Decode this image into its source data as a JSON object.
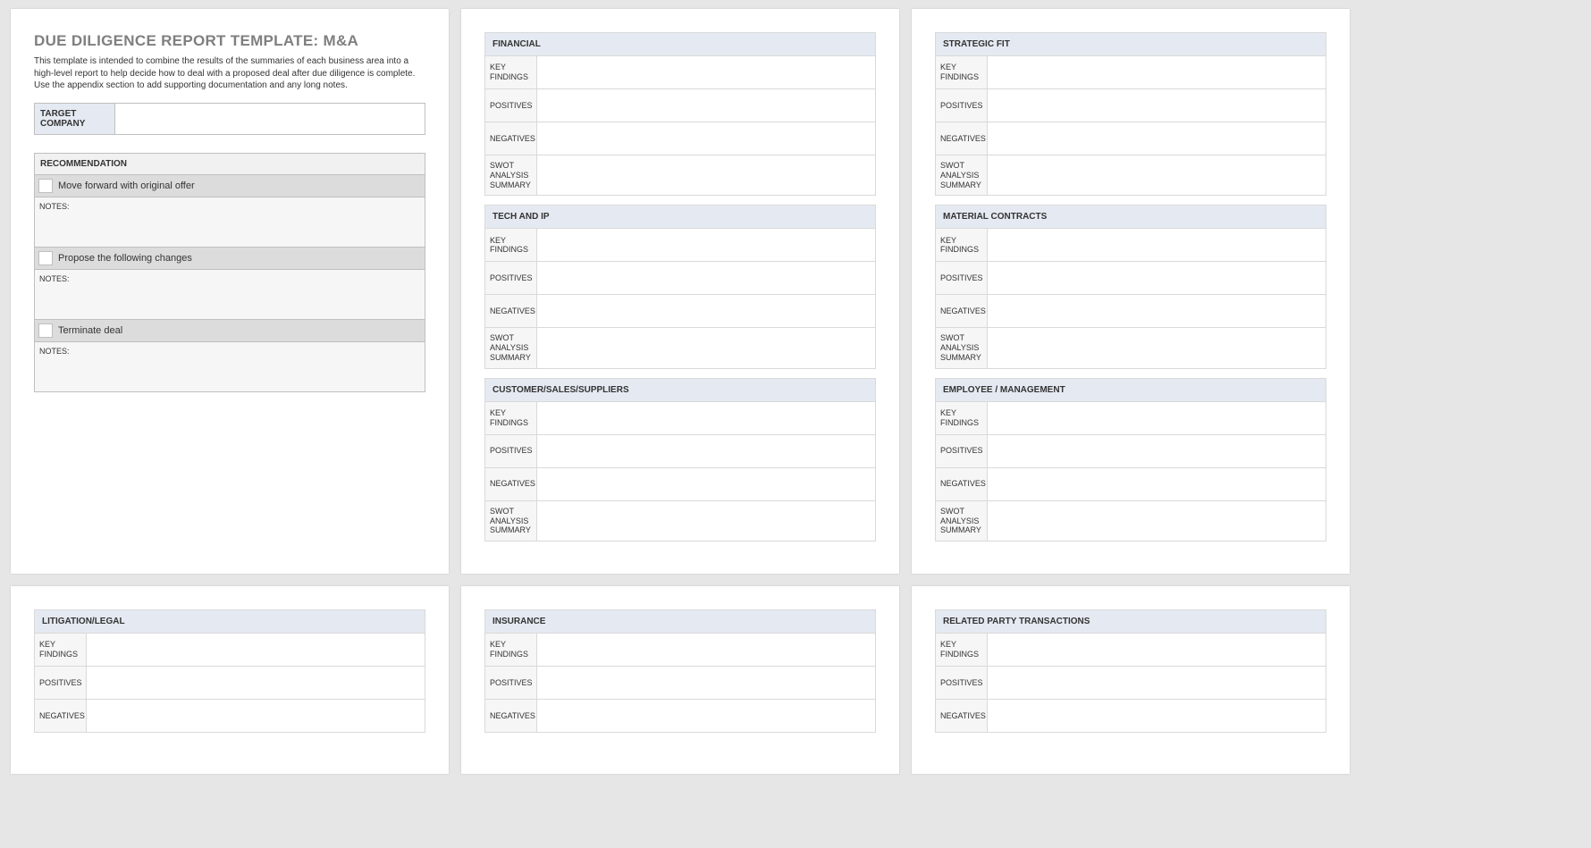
{
  "title": "DUE DILIGENCE REPORT TEMPLATE: M&A",
  "intro": "This template is intended to combine the results of the summaries of each business area into a high-level report to help decide how to deal with a proposed deal after due diligence is complete.  Use the appendix section to add supporting documentation and any long notes.",
  "target_label": "TARGET COMPANY",
  "target_value": "",
  "rec_header": "RECOMMENDATION",
  "rec_options": [
    {
      "label": "Move forward with original offer",
      "notes_label": "NOTES:"
    },
    {
      "label": "Propose the following changes",
      "notes_label": "NOTES:"
    },
    {
      "label": "Terminate deal",
      "notes_label": "NOTES:"
    }
  ],
  "row_labels": {
    "key_findings": "KEY FINDINGS",
    "positives": "POSITIVES",
    "negatives": "NEGATIVES",
    "swot": "SWOT ANALYSIS SUMMARY"
  },
  "sections_col2": [
    "FINANCIAL",
    "TECH AND IP",
    "CUSTOMER/SALES/SUPPLIERS"
  ],
  "sections_col3": [
    "STRATEGIC FIT",
    "MATERIAL CONTRACTS",
    "EMPLOYEE / MANAGEMENT"
  ],
  "sections_row2": [
    "LITIGATION/LEGAL",
    "INSURANCE",
    "RELATED PARTY TRANSACTIONS"
  ]
}
